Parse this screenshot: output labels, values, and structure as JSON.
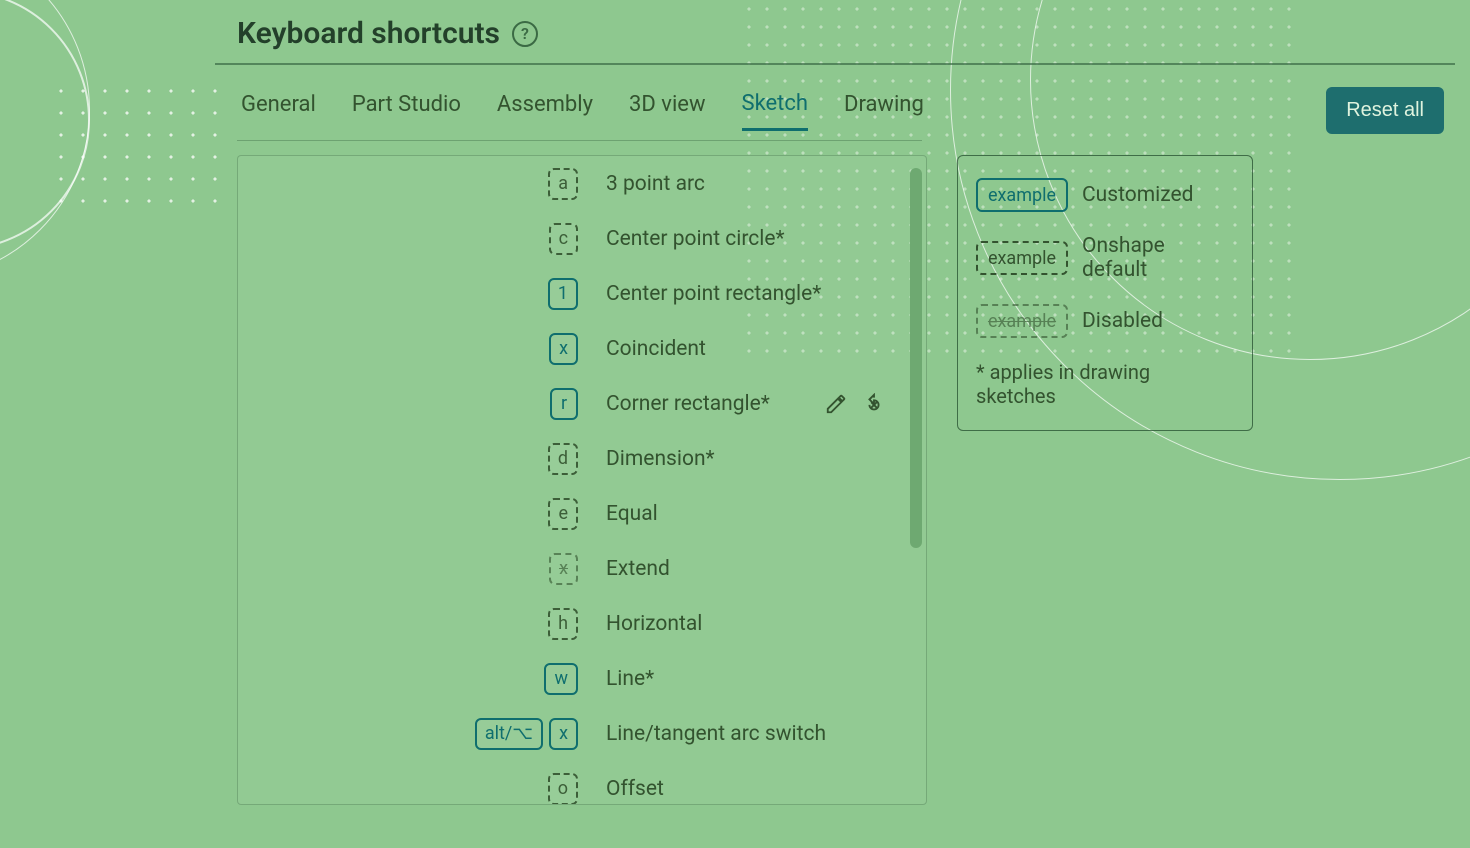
{
  "header": {
    "title": "Keyboard shortcuts",
    "help_glyph": "?"
  },
  "tabs": [
    {
      "label": "General",
      "active": false
    },
    {
      "label": "Part Studio",
      "active": false
    },
    {
      "label": "Assembly",
      "active": false
    },
    {
      "label": "3D view",
      "active": false
    },
    {
      "label": "Sketch",
      "active": true
    },
    {
      "label": "Drawing",
      "active": false
    }
  ],
  "reset_label": "Reset all",
  "shortcuts": [
    {
      "keys": [
        {
          "text": "a",
          "style": "default"
        }
      ],
      "label": "3 point arc",
      "show_actions": false
    },
    {
      "keys": [
        {
          "text": "c",
          "style": "default"
        }
      ],
      "label": "Center point circle*",
      "show_actions": false
    },
    {
      "keys": [
        {
          "text": "1",
          "style": "customized"
        }
      ],
      "label": "Center point rectangle*",
      "show_actions": false
    },
    {
      "keys": [
        {
          "text": "x",
          "style": "customized"
        }
      ],
      "label": "Coincident",
      "show_actions": false
    },
    {
      "keys": [
        {
          "text": "r",
          "style": "customized"
        }
      ],
      "label": "Corner rectangle*",
      "show_actions": true
    },
    {
      "keys": [
        {
          "text": "d",
          "style": "default"
        }
      ],
      "label": "Dimension*",
      "show_actions": false
    },
    {
      "keys": [
        {
          "text": "e",
          "style": "default"
        }
      ],
      "label": "Equal",
      "show_actions": false
    },
    {
      "keys": [
        {
          "text": "x",
          "style": "disabled"
        }
      ],
      "label": "Extend",
      "show_actions": false
    },
    {
      "keys": [
        {
          "text": "h",
          "style": "default"
        }
      ],
      "label": "Horizontal",
      "show_actions": false
    },
    {
      "keys": [
        {
          "text": "w",
          "style": "customized"
        }
      ],
      "label": "Line*",
      "show_actions": false
    },
    {
      "keys": [
        {
          "text": "alt/⌥",
          "style": "customized"
        },
        {
          "text": "x",
          "style": "customized"
        }
      ],
      "label": "Line/tangent arc switch",
      "show_actions": false
    },
    {
      "keys": [
        {
          "text": "o",
          "style": "default"
        }
      ],
      "label": "Offset",
      "show_actions": false
    }
  ],
  "legend": {
    "sample_text": "example",
    "customized": "Customized",
    "default": "Onshape default",
    "disabled": "Disabled",
    "note": "* applies in drawing sketches"
  }
}
